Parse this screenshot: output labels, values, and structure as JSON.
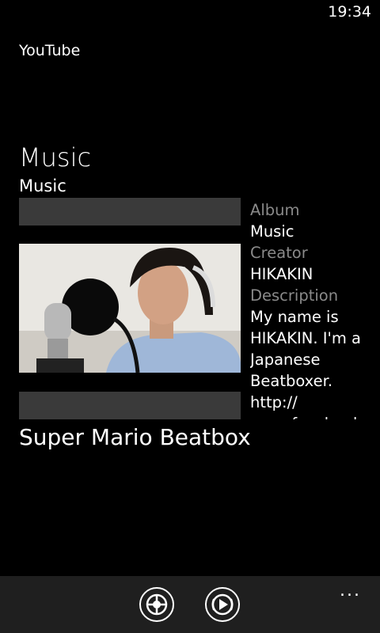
{
  "status": {
    "time": "19:34"
  },
  "app": {
    "title": "YouTube"
  },
  "page": {
    "title": "Music",
    "subtitle": "Music"
  },
  "details": {
    "album_label": "Album",
    "album_value": "Music",
    "creator_label": "Creator",
    "creator_value": "HIKAKIN",
    "description_label": "Description",
    "description_value": "My name is HIKAKIN. I'm a Japanese Beatboxer. http:// www.facebook"
  },
  "video": {
    "title": "Super Mario Beatbox"
  },
  "appbar": {
    "add_icon": "add-icon",
    "play_icon": "play-icon",
    "more_label": "..."
  }
}
